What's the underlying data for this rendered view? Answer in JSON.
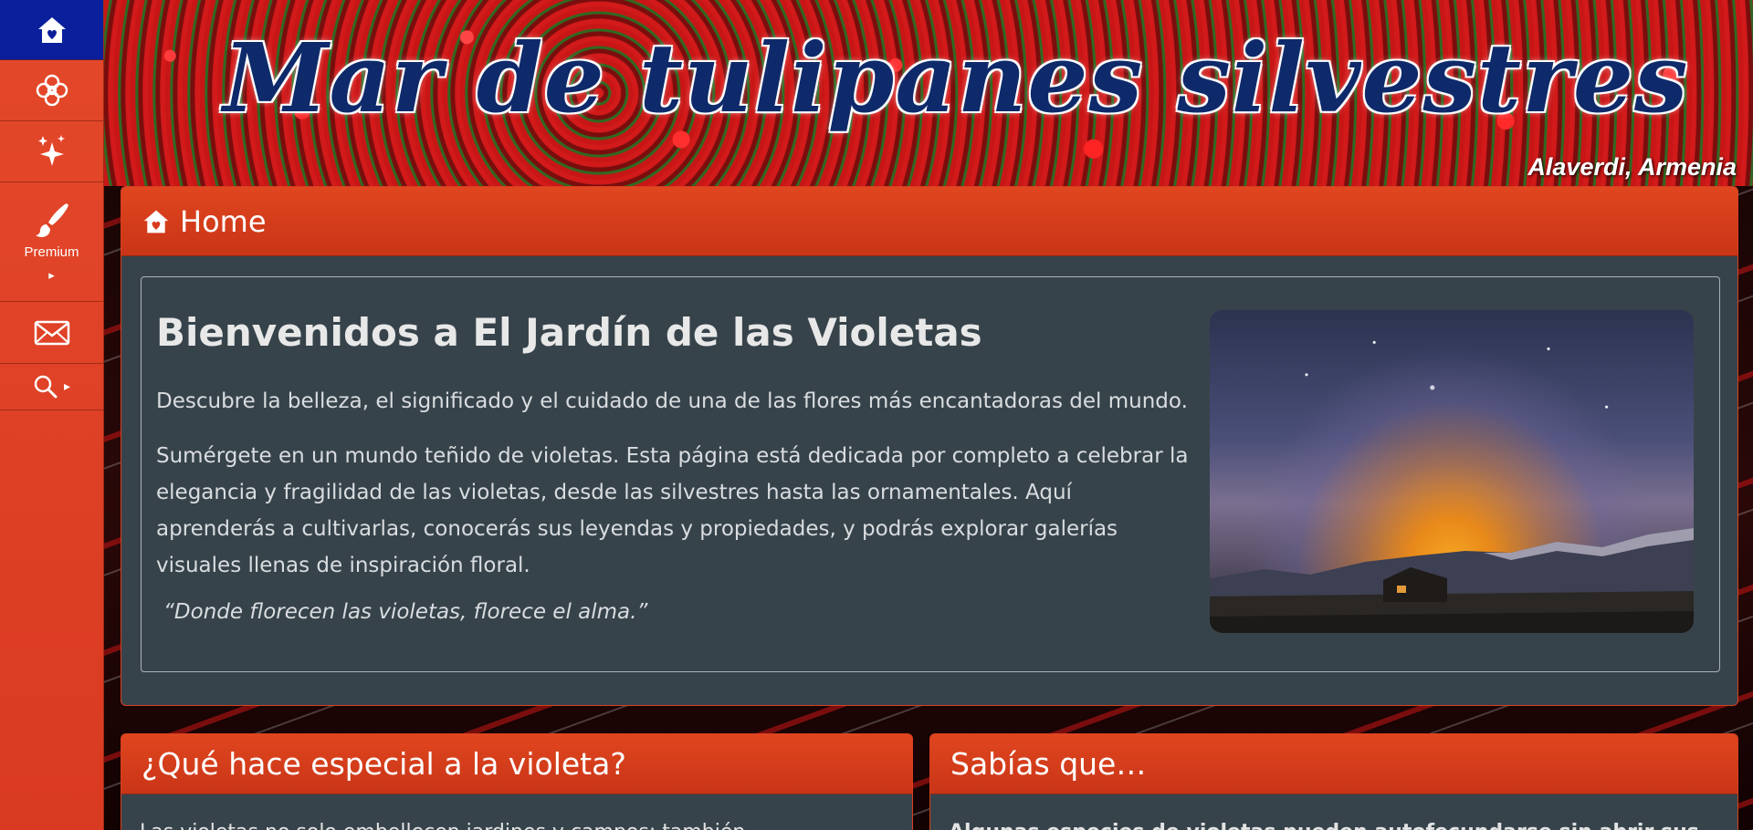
{
  "sidebar": {
    "items": [
      {
        "icon": "home-icon",
        "label": ""
      },
      {
        "icon": "flower-icon",
        "label": ""
      },
      {
        "icon": "sparkles-icon",
        "label": ""
      },
      {
        "icon": "brush-icon",
        "label": "Premium"
      },
      {
        "icon": "mail-icon",
        "label": ""
      },
      {
        "icon": "search-icon",
        "label": ""
      }
    ]
  },
  "banner": {
    "title": "Mar de tulipanes silvestres",
    "subtitle": "Alaverdi, Armenia"
  },
  "main": {
    "heading": "Home",
    "title": "Bienvenidos a El Jardín de las Violetas",
    "intro": "Descubre la belleza, el significado y el cuidado de una de las flores más encantadoras del mundo.",
    "body": "Sumérgete en un mundo teñido de violetas. Esta página está dedicada por completo a celebrar la elegancia y fragilidad de las violetas, desde las silvestres hasta las ornamentales. Aquí aprenderás a cultivarlas, conocerás sus leyendas y propiedades, y podrás explorar galerías visuales llenas de inspiración floral.",
    "quote": "“Donde florecen las violetas, florece el alma.”"
  },
  "cards": [
    {
      "heading": "¿Qué hace especial a la violeta?",
      "text": "Las violetas no solo embellecen jardines y campos; también"
    },
    {
      "heading": "Sabías que…",
      "text": "Algunas especies de violetas pueden autofecundarse sin abrir sus"
    }
  ],
  "colors": {
    "accent": "#e0461f",
    "home_active": "#0b1f9c",
    "panel_bg": "#37434b",
    "title_blue": "#0f2a6b"
  }
}
